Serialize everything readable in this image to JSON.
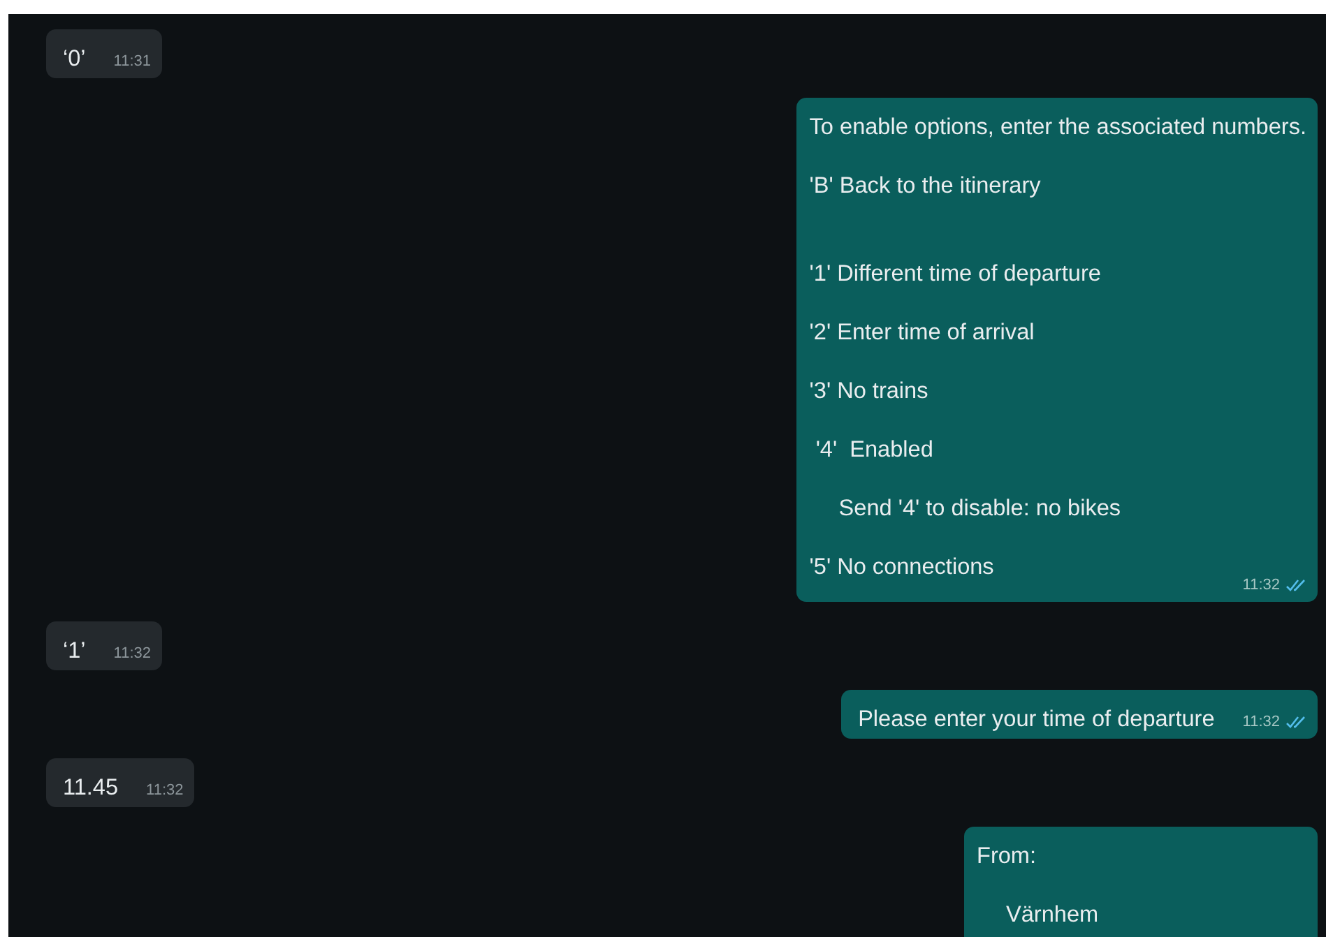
{
  "messages": [
    {
      "kind": "incoming",
      "lines": [
        {
          "text": "‘0’",
          "spaced": false,
          "indented": false
        }
      ],
      "time": "11:31"
    },
    {
      "kind": "outgoing",
      "lines": [
        {
          "text": "To enable options, enter the associated numbers.",
          "spaced": false,
          "indented": false
        },
        {
          "text": "'B' Back to the itinerary",
          "spaced": false,
          "indented": false
        },
        {
          "text": "'1' Different time of departure",
          "spaced": true,
          "indented": false
        },
        {
          "text": "'2' Enter time of arrival",
          "spaced": false,
          "indented": false
        },
        {
          "text": "'3' No trains",
          "spaced": false,
          "indented": false
        },
        {
          "text": " '4'  Enabled",
          "spaced": false,
          "indented": false
        },
        {
          "text": "Send '4' to disable: no bikes",
          "spaced": false,
          "indented": true
        },
        {
          "text": "'5' No connections",
          "spaced": false,
          "indented": false
        }
      ],
      "time": "11:32",
      "read": true
    },
    {
      "kind": "incoming",
      "lines": [
        {
          "text": "‘1’",
          "spaced": false,
          "indented": false
        }
      ],
      "time": "11:32"
    },
    {
      "kind": "outgoing",
      "lines": [
        {
          "text": "Please enter your time of departure",
          "spaced": false,
          "indented": false
        }
      ],
      "time": "11:32",
      "read": true
    },
    {
      "kind": "incoming",
      "lines": [
        {
          "text": "11.45",
          "spaced": false,
          "indented": false
        }
      ],
      "time": "11:32"
    },
    {
      "kind": "outgoing",
      "lines": [
        {
          "text": "From:",
          "spaced": false,
          "indented": false
        },
        {
          "text": "Värnhem",
          "spaced": false,
          "indented": true
        }
      ]
    }
  ]
}
